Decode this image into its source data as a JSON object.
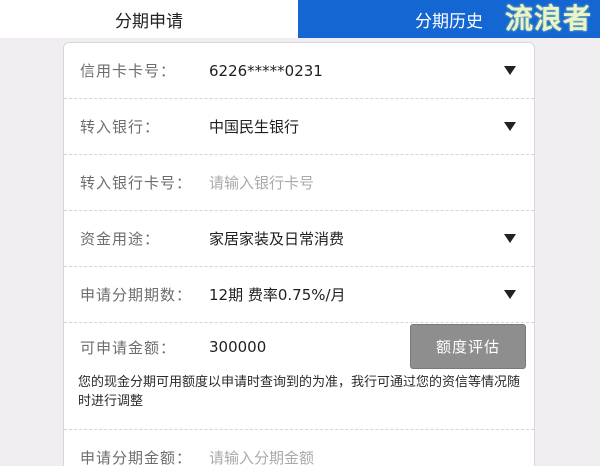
{
  "tabs": {
    "apply": "分期申请",
    "history": "分期历史"
  },
  "watermark": "流浪者",
  "form": {
    "card_number": {
      "label": "信用卡卡号：",
      "value": "6226*****0231"
    },
    "bank": {
      "label": "转入银行：",
      "value": "中国民生银行"
    },
    "bank_card": {
      "label": "转入银行卡号：",
      "placeholder": "请输入银行卡号"
    },
    "usage": {
      "label": "资金用途：",
      "value": "家居家装及日常消费"
    },
    "periods": {
      "label": "申请分期期数：",
      "value": "12期 费率0.75%/月"
    },
    "available": {
      "label": "可申请金额：",
      "value": "300000",
      "button": "额度评估"
    },
    "note": "您的现金分期可用额度以申请时查询到的为准，我行可通过您的资信等情况随时进行调整",
    "amount": {
      "label": "申请分期金额：",
      "placeholder": "请输入分期金额"
    }
  },
  "colors": {
    "active_tab": "#1466d2",
    "button": "#8e8e8e"
  },
  "icons": {
    "dropdown": "caret-down-icon"
  }
}
